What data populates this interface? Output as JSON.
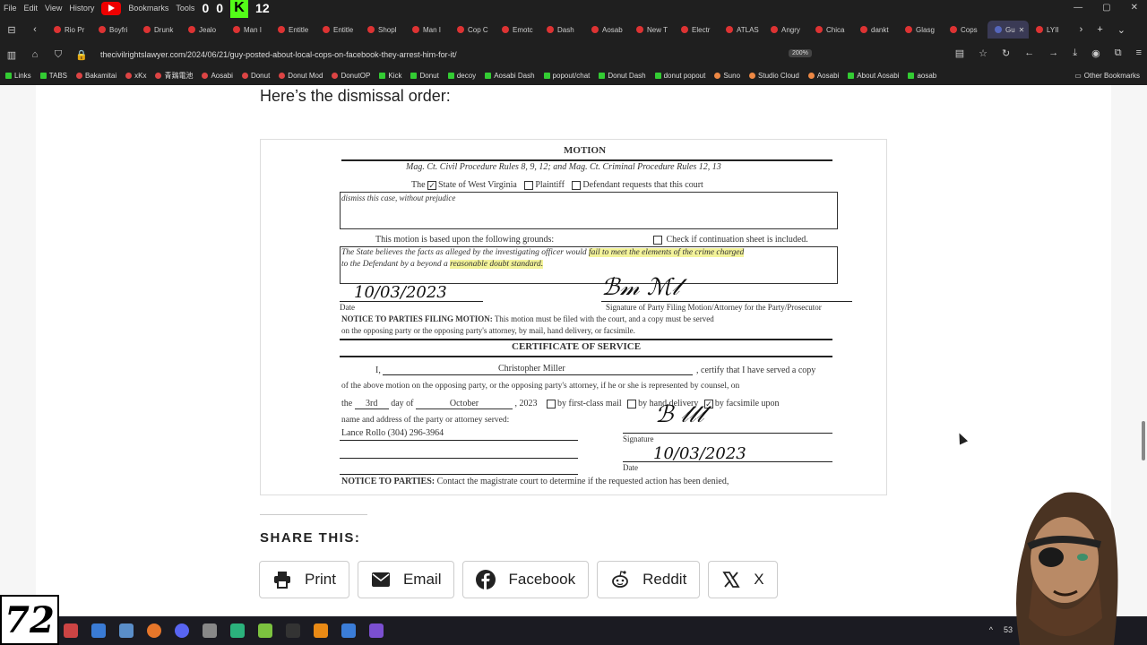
{
  "menu": {
    "file": "File",
    "edit": "Edit",
    "view": "View",
    "history": "History",
    "bookmarks": "Bookmarks",
    "tools": "Tools",
    "count_a": "0",
    "count_b": "0",
    "count_c": "12"
  },
  "tabs": [
    "Rio Pr",
    "Boyfri",
    "Drunk",
    "Jealo",
    "Man I",
    "Entitle",
    "Entitle",
    "Shopl",
    "Man I",
    "Cop C",
    "Emotc",
    "Dash",
    "Aosab",
    "New T",
    "Electr",
    "ATLAS",
    "Angry",
    "Chica",
    "dankt",
    "Glasg",
    "Cops",
    "Gu",
    "LYII"
  ],
  "address": {
    "url": "thecivilrightslawyer.com/2024/06/21/guy-posted-about-local-cops-on-facebook-they-arrest-him-for-it/",
    "zoom": "200%"
  },
  "bookmarks": [
    "Links",
    "TABS",
    "Bakamitai",
    "xKx",
    "青鶏電池",
    "Aosabi",
    "Donut",
    "Donut Mod",
    "DonutOP",
    "Kick",
    "Donut",
    "decoy",
    "Aosabi Dash",
    "popout/chat",
    "Donut Dash",
    "donut popout",
    "Suno",
    "Studio Cloud",
    "Aosabi",
    "About Aosabi",
    "aosab"
  ],
  "bookmarks_other": "Other Bookmarks",
  "article": {
    "intro": "Here’s the dismissal order:"
  },
  "doc": {
    "title": "MOTION",
    "rules": "Mag. Ct. Civil Procedure Rules 8, 9, 12; and Mag. Ct. Criminal Procedure Rules 12, 13",
    "the": "The",
    "opt_state": "State of West Virginia",
    "opt_plaintiff": "Plaintiff",
    "opt_defendant": "Defendant requests that this court",
    "request": "dismiss this case, without prejudice",
    "grounds": "This motion is based upon the following grounds:",
    "continuation": "Check if continuation sheet is included.",
    "grounds_text1a": "The State believes the facts as alleged by the investigating officer would",
    "grounds_text1b": "fail to meet the elements of the crime charged",
    "grounds_text2a": "to the Defendant by a beyond a",
    "grounds_text2b": "reasonable doubt standard.",
    "date_hand": "10/03/2023",
    "date_label": "Date",
    "sig_label": "Signature of Party Filing Motion/Attorney for the Party/Prosecutor",
    "notice1": "NOTICE TO PARTIES FILING MOTION:",
    "notice1_text": "This motion must be filed with the court, and a copy must be served",
    "notice1_text2": "on the opposing party or the opposing party's attorney, by mail, hand delivery, or facsimile.",
    "cert_title": "CERTIFICATE OF SERVICE",
    "cert_i": "I,",
    "cert_name": "Christopher Miller",
    "cert_certify": ", certify that I have served a copy",
    "cert_line2": "of the above motion on the opposing party, or the opposing party's attorney, if he or she is represented by counsel, on",
    "cert_the": "the",
    "cert_day": "3rd",
    "cert_dayof": "day of",
    "cert_month": "October",
    "cert_year": ", 2023",
    "cert_mail": "by first-class mail",
    "cert_hand": "by hand delivery",
    "cert_fax": "by facsimile upon",
    "cert_nameaddr": "name and address of the party or attorney served:",
    "served": "Lance Rollo (304) 296-3964",
    "signature_label": "Signature",
    "date_label2": "Date",
    "date_hand2": "10/03/2023",
    "notice2": "NOTICE TO PARTIES:",
    "notice2_text": "Contact the magistrate court to determine if the requested action has been denied,"
  },
  "share": {
    "title": "SHARE THIS:",
    "buttons": {
      "print": "Print",
      "email": "Email",
      "facebook": "Facebook",
      "reddit": "Reddit",
      "x": "X"
    }
  },
  "tray": {
    "count": "53"
  },
  "overlay": {
    "logo": "72"
  }
}
